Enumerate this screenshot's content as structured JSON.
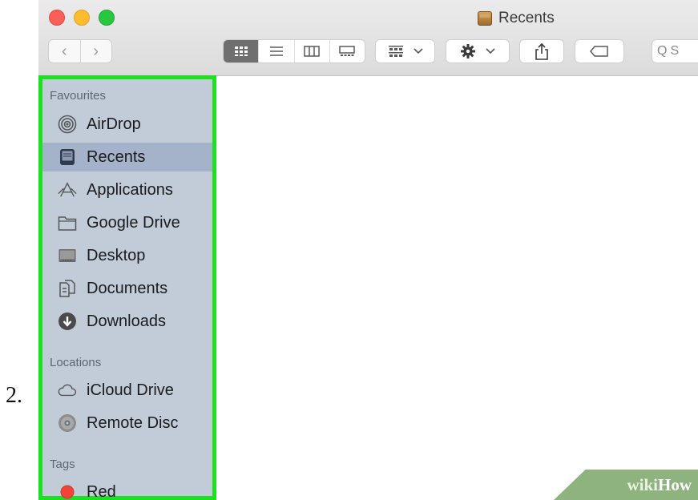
{
  "step_number": "2.",
  "window": {
    "title": "Recents"
  },
  "toolbar": {
    "back_glyph": "‹",
    "forward_glyph": "›",
    "search_glyph": "Q",
    "search_placeholder": "S"
  },
  "sidebar": {
    "highlight_color": "#1ee023",
    "sections": [
      {
        "heading": "Favourites"
      },
      {
        "heading": "Locations"
      },
      {
        "heading": "Tags"
      }
    ],
    "items": [
      {
        "label": "AirDrop",
        "icon": "airdrop-icon"
      },
      {
        "label": "Recents",
        "icon": "recents-icon",
        "selected": true
      },
      {
        "label": "Applications",
        "icon": "applications-icon"
      },
      {
        "label": "Google Drive",
        "icon": "folder-icon"
      },
      {
        "label": "Desktop",
        "icon": "desktop-icon"
      },
      {
        "label": "Documents",
        "icon": "documents-icon"
      },
      {
        "label": "Downloads",
        "icon": "downloads-icon"
      },
      {
        "label": "iCloud Drive",
        "icon": "cloud-icon"
      },
      {
        "label": "Remote Disc",
        "icon": "disc-icon"
      },
      {
        "label": "Red",
        "icon": "red-tag-icon",
        "color": "#f0433a"
      }
    ]
  },
  "watermark": {
    "part1": "wiki",
    "part2": "How",
    "color": "#8fb37e"
  }
}
